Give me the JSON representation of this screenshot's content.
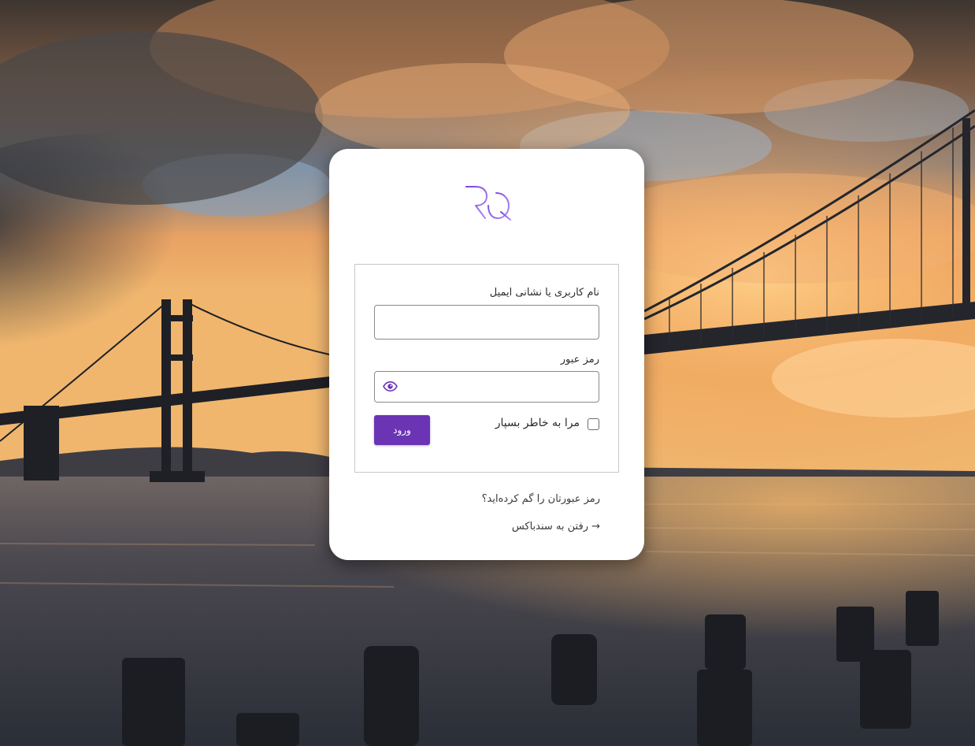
{
  "background": {
    "description_icon": "bay-bridge-sunset-photo"
  },
  "logo": {
    "icon": "rq-logo-icon",
    "colors": [
      "#7b3fe4",
      "#b28cf0"
    ]
  },
  "login_form": {
    "username_label": "نام کاربری یا نشانی ایمیل",
    "username_value": "",
    "password_label": "رمز عبور",
    "password_value": "",
    "show_password_icon": "eye-icon",
    "remember_me_label": "مرا به خاطر بسپار",
    "remember_me_checked": false,
    "submit_label": "ورود"
  },
  "links": {
    "lost_password": "رمز عبورتان را گم کرده‌اید؟",
    "back_to_site": "→ رفتن به سندباکس"
  },
  "colors": {
    "accent": "#6b34b5",
    "card_background": "#ffffff"
  }
}
